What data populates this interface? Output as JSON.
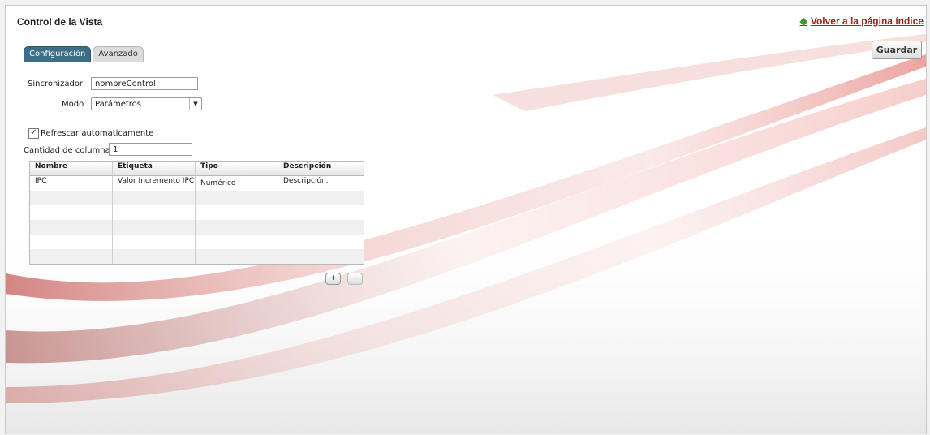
{
  "header": {
    "title": "Control de la Vista",
    "back_link": "Volver a la página índice",
    "save_label": "Guardar"
  },
  "tabs": [
    {
      "label": "Configuración",
      "active": true
    },
    {
      "label": "Avanzado",
      "active": false
    }
  ],
  "form": {
    "synchronizer_label": "Sincronizador",
    "synchronizer_value": "nombreControl",
    "mode_label": "Modo",
    "mode_value": "Parámetros",
    "auto_refresh_label": "Refrescar automaticamente",
    "auto_refresh_checked": true,
    "columns_label": "Cantidad de columnas",
    "columns_value": "1"
  },
  "grid": {
    "headers": [
      "Nombre",
      "Etiqueta",
      "Tipo",
      "Descripción"
    ],
    "rows": [
      [
        "IPC",
        "Valor Incremento IPC",
        "Numérico",
        "Descripción."
      ],
      [
        "",
        "",
        "",
        ""
      ],
      [
        "",
        "",
        "",
        ""
      ],
      [
        "",
        "",
        "",
        ""
      ],
      [
        "",
        "",
        "",
        ""
      ],
      [
        "",
        "",
        "",
        ""
      ]
    ],
    "add_label": "+",
    "remove_label": "-"
  },
  "colors": {
    "accent_tab": "#3d6e88",
    "link": "#a4201a",
    "arrow": "#3f9a2e",
    "swoosh": "#c8362e"
  },
  "icons": {
    "back": "arrow-left-icon",
    "select": "chevron-down-icon",
    "checkbox": "check-icon"
  }
}
